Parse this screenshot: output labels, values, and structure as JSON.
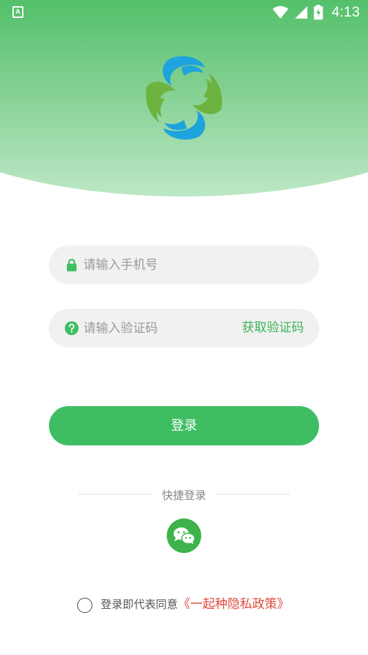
{
  "status_bar": {
    "app_icon_letter": "A",
    "time": "4:13",
    "icons": [
      "wifi-icon",
      "cell-signal-icon",
      "battery-charging-icon"
    ]
  },
  "colors": {
    "brand_green": "#3fbd63",
    "link_red": "#e04b3f",
    "logo_blue": "#1fa3dd",
    "logo_green": "#6db33f"
  },
  "form": {
    "phone_placeholder": "请输入手机号",
    "phone_value": "",
    "code_placeholder": "请输入验证码",
    "code_value": "",
    "get_code_label": "获取验证码",
    "login_label": "登录"
  },
  "quick_login": {
    "label": "快捷登录",
    "providers": [
      "wechat-icon"
    ]
  },
  "agreement": {
    "checked": false,
    "prefix": "登录即代表同意",
    "link": "《一起种隐私政策》"
  }
}
